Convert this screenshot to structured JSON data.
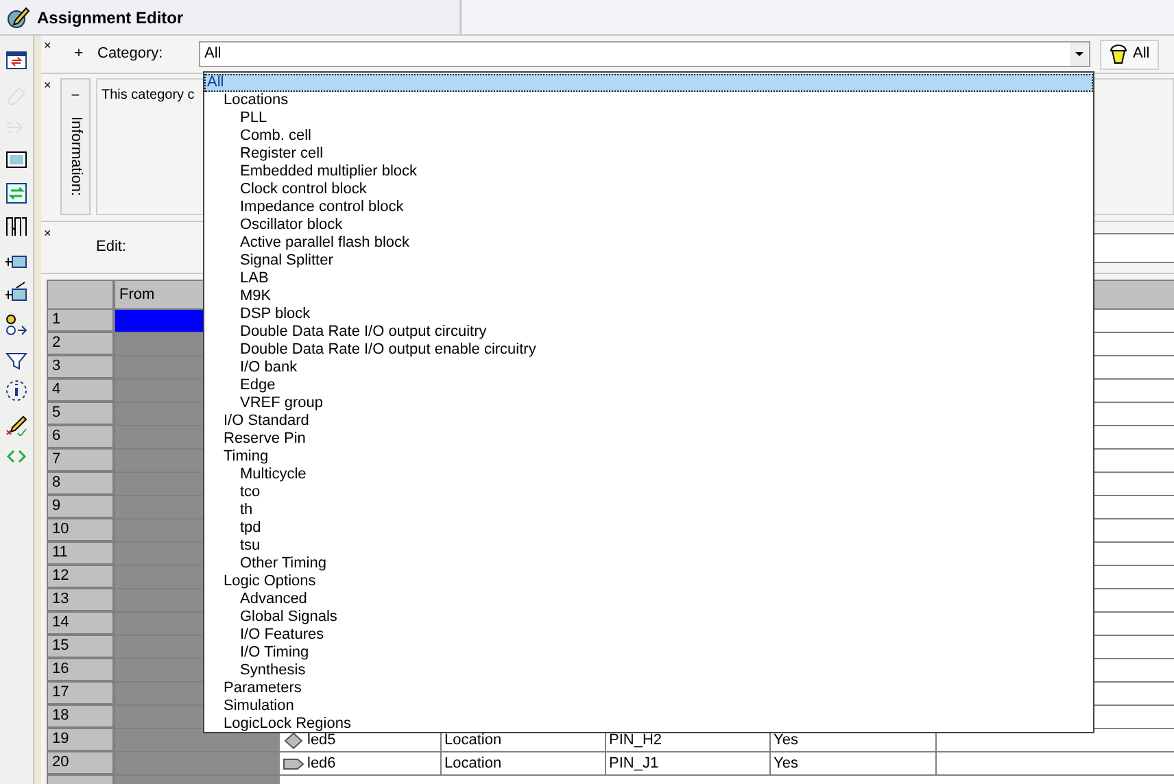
{
  "window": {
    "title": "Assignment Editor"
  },
  "toolbar": [
    {
      "kind": "window",
      "disabled": false
    },
    {
      "kind": "eraser",
      "disabled": true
    },
    {
      "kind": "arrow",
      "disabled": true
    },
    {
      "kind": "frame",
      "disabled": false
    },
    {
      "kind": "refresh",
      "disabled": false
    },
    {
      "kind": "columns",
      "disabled": false
    },
    {
      "kind": "numbered",
      "disabled": false
    },
    {
      "kind": "check",
      "disabled": false
    },
    {
      "kind": "nodes",
      "disabled": false
    },
    {
      "kind": "filter",
      "disabled": false
    },
    {
      "kind": "info",
      "disabled": false
    },
    {
      "kind": "pencil",
      "disabled": false
    },
    {
      "kind": "chevrons",
      "disabled": false
    }
  ],
  "category": {
    "close": "×",
    "toggle": "+",
    "label": "Category:",
    "value": "All",
    "filter_button": "All"
  },
  "information": {
    "close": "×",
    "toggle": "−",
    "label": "Information:",
    "text": "This category c"
  },
  "edit": {
    "close": "×",
    "label": "Edit:"
  },
  "table": {
    "columns": [
      "From"
    ],
    "rows": [
      {
        "number": "1",
        "selected": true
      },
      {
        "number": "2",
        "selected": false
      },
      {
        "number": "3",
        "selected": false
      },
      {
        "number": "4",
        "selected": false
      },
      {
        "number": "5",
        "selected": false
      },
      {
        "number": "6",
        "selected": false
      },
      {
        "number": "7",
        "selected": false
      },
      {
        "number": "8",
        "selected": false
      },
      {
        "number": "9",
        "selected": false
      },
      {
        "number": "10",
        "selected": false
      },
      {
        "number": "11",
        "selected": false
      },
      {
        "number": "12",
        "selected": false
      },
      {
        "number": "13",
        "selected": false
      },
      {
        "number": "14",
        "selected": false
      },
      {
        "number": "15",
        "selected": false
      },
      {
        "number": "16",
        "selected": false
      },
      {
        "number": "17",
        "selected": false
      },
      {
        "number": "18",
        "selected": false
      },
      {
        "number": "19",
        "selected": false,
        "kind": "unknown",
        "to": "led5",
        "assignment": "Location",
        "value": "PIN_H2",
        "enabled": "Yes"
      },
      {
        "number": "20",
        "selected": false,
        "kind": "output",
        "to": "led6",
        "assignment": "Location",
        "value": "PIN_J1",
        "enabled": "Yes"
      }
    ]
  },
  "dropdown": {
    "items": [
      {
        "label": "All",
        "selected": true,
        "children": [
          {
            "label": "Locations",
            "selected": false,
            "children": [
              {
                "label": "PLL",
                "selected": false
              },
              {
                "label": "Comb. cell",
                "selected": false
              },
              {
                "label": "Register cell",
                "selected": false
              },
              {
                "label": "Embedded multiplier block",
                "selected": false
              },
              {
                "label": "Clock control block",
                "selected": false
              },
              {
                "label": "Impedance control block",
                "selected": false
              },
              {
                "label": "Oscillator block",
                "selected": false
              },
              {
                "label": "Active parallel flash block",
                "selected": false
              },
              {
                "label": "Signal Splitter",
                "selected": false
              },
              {
                "label": "LAB",
                "selected": false
              },
              {
                "label": "M9K",
                "selected": false
              },
              {
                "label": "DSP block",
                "selected": false
              },
              {
                "label": "Double Data Rate I/O output circuitry",
                "selected": false
              },
              {
                "label": "Double Data Rate I/O output enable circuitry",
                "selected": false
              },
              {
                "label": "I/O bank",
                "selected": false
              },
              {
                "label": "Edge",
                "selected": false
              },
              {
                "label": "VREF group",
                "selected": false
              }
            ]
          },
          {
            "label": "I/O Standard",
            "selected": false
          },
          {
            "label": "Reserve Pin",
            "selected": false
          },
          {
            "label": "Timing",
            "selected": false,
            "children": [
              {
                "label": "Multicycle",
                "selected": false
              },
              {
                "label": "tco",
                "selected": false
              },
              {
                "label": "th",
                "selected": false
              },
              {
                "label": "tpd",
                "selected": false
              },
              {
                "label": "tsu",
                "selected": false
              },
              {
                "label": "Other Timing",
                "selected": false
              }
            ]
          },
          {
            "label": "Logic Options",
            "selected": false,
            "children": [
              {
                "label": "Advanced",
                "selected": false
              },
              {
                "label": "Global Signals",
                "selected": false
              },
              {
                "label": "I/O Features",
                "selected": false
              },
              {
                "label": "I/O Timing",
                "selected": false
              },
              {
                "label": "Synthesis",
                "selected": false
              }
            ]
          },
          {
            "label": "Parameters",
            "selected": false
          },
          {
            "label": "Simulation",
            "selected": false
          },
          {
            "label": "LogicLock Regions",
            "selected": false
          }
        ]
      }
    ]
  }
}
